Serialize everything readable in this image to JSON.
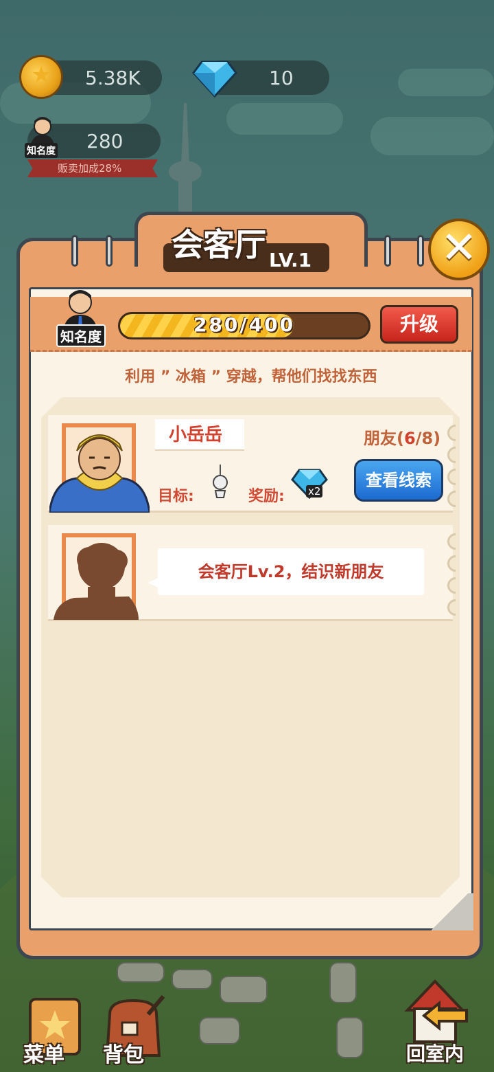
{
  "hud": {
    "coins": "5.38K",
    "gems": "10",
    "fame_value": "280",
    "fame_tag": "知名度",
    "sales_bonus": "贩卖加成28%"
  },
  "panel": {
    "title": "会客厅",
    "level": "LV.1",
    "fame_tag": "知名度",
    "progress_text": "280/400",
    "progress_fraction": 0.7,
    "upgrade_label": "升级",
    "hint": "利用 ” 冰箱 ” 穿越，帮他们找找东西"
  },
  "friend_card": {
    "name": "小岳岳",
    "friends_prefix": "朋友(",
    "friends_current": "6",
    "friends_suffix": "/8)",
    "target_label": "目标:",
    "reward_label": "奖励:",
    "reward_multiplier": "x2",
    "clue_button": "查看线索"
  },
  "locked_card": {
    "message": "会客厅Lv.2，结识新朋友"
  },
  "bottom_nav": {
    "menu": "菜单",
    "backpack": "背包",
    "home": "回室内"
  }
}
